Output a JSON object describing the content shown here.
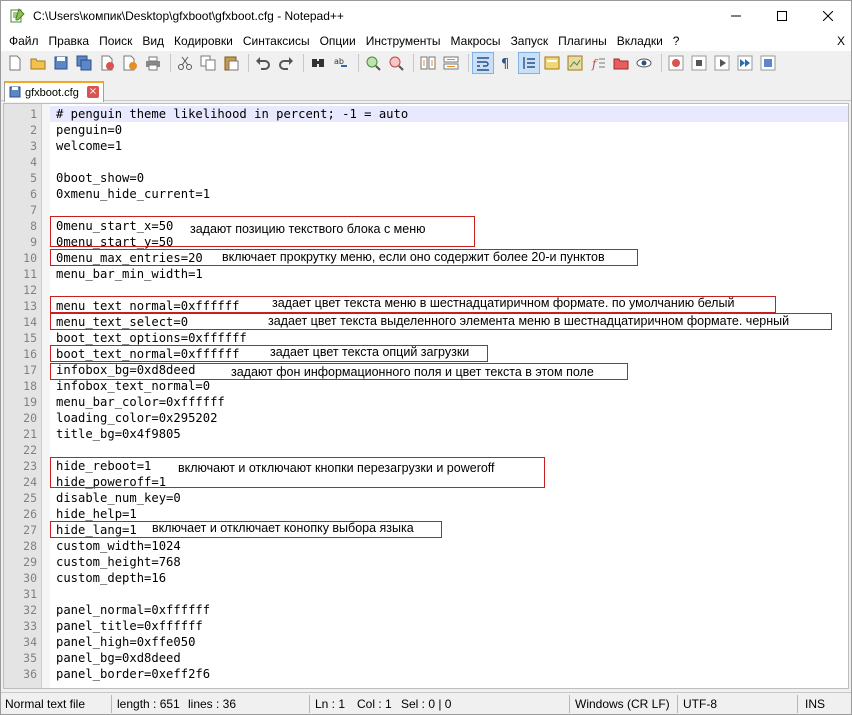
{
  "window": {
    "title": "C:\\Users\\компик\\Desktop\\gfxboot\\gfxboot.cfg - Notepad++"
  },
  "menu": {
    "items": [
      "Файл",
      "Правка",
      "Поиск",
      "Вид",
      "Кодировки",
      "Синтаксисы",
      "Опции",
      "Инструменты",
      "Макросы",
      "Запуск",
      "Плагины",
      "Вкладки",
      "?"
    ],
    "close_label": "X"
  },
  "toolbar": {
    "icons": [
      "new-file-icon",
      "open-file-icon",
      "save-icon",
      "save-all-icon",
      "close-icon",
      "close-all-icon",
      "print-icon",
      "cut-icon",
      "copy-icon",
      "paste-icon",
      "undo-icon",
      "redo-icon",
      "find-icon",
      "replace-icon",
      "zoom-in-icon",
      "zoom-out-icon",
      "sync-vertical-icon",
      "sync-horizontal-icon",
      "word-wrap-icon",
      "show-all-chars-icon",
      "indent-guide-icon",
      "doc-map-icon",
      "function-list-icon",
      "folder-workspace-icon",
      "monitor-icon",
      "record-macro-icon",
      "stop-macro-icon",
      "play-macro-icon",
      "run-macro-multiple-icon",
      "save-macro-icon"
    ]
  },
  "tab": {
    "label": "gfxboot.cfg",
    "close_label": "×"
  },
  "editor": {
    "lines": [
      "# penguin theme likelihood in percent; -1 = auto",
      "penguin=0",
      "welcome=1",
      "",
      "0boot_show=0",
      "0xmenu_hide_current=1",
      "",
      "0menu_start_x=50",
      "0menu_start_y=50",
      "0menu_max_entries=20",
      "menu_bar_min_width=1",
      "",
      "menu_text_normal=0xffffff",
      "menu_text_select=0",
      "boot_text_options=0xffffff",
      "boot_text_normal=0xffffff",
      "infobox_bg=0xd8deed",
      "infobox_text_normal=0",
      "menu_bar_color=0xffffff",
      "loading_color=0x295202",
      "title_bg=0x4f9805",
      "",
      "hide_reboot=1",
      "hide_poweroff=1",
      "disable_num_key=0",
      "hide_help=1",
      "hide_lang=1",
      "custom_width=1024",
      "custom_height=768",
      "custom_depth=16",
      "",
      "panel_normal=0xffffff",
      "panel_title=0xffffff",
      "panel_high=0xffe050",
      "panel_bg=0xd8deed",
      "panel_border=0xeff2f6"
    ]
  },
  "annotations": [
    {
      "text": "задают позицию текствого блока с меню"
    },
    {
      "text": "включает прокрутку меню, если оно содержит более 20-и пунктов"
    },
    {
      "text": "задает цвет текста меню в шестнадцатиричном формате. по умолчанию белый"
    },
    {
      "text": "задает цвет текста выделенного элемента меню в шестнадцатиричном формате. черный"
    },
    {
      "text": "задает цвет текста опций загрузки"
    },
    {
      "text": "задают фон информационного поля и цвет текста в этом поле"
    },
    {
      "text": "включают и отключают кнопки перезагрузки и poweroff"
    },
    {
      "text": "включает и отключает конопку выбора языка"
    }
  ],
  "status": {
    "file_type": "Normal text file",
    "length": "length : 651",
    "lines": "lines : 36",
    "ln": "Ln : 1",
    "col": "Col : 1",
    "sel": "Sel : 0 | 0",
    "eol": "Windows (CR LF)",
    "encoding": "UTF-8",
    "mode": "INS"
  },
  "colors": {
    "annotation_border": "#c81e1e",
    "gutter": "#e4e4e4",
    "tab_accent": "#f5a623"
  }
}
